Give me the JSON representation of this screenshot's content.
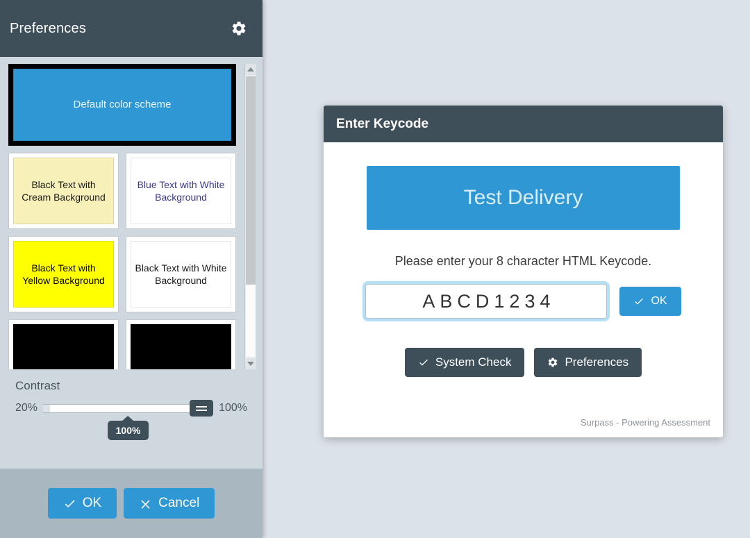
{
  "preferences": {
    "title": "Preferences",
    "gear_icon": "gear-icon",
    "schemes": [
      {
        "label": "Default color scheme",
        "bg": "#2f97d4",
        "fg": "#e9f5fd",
        "selected": true,
        "size": "wide"
      },
      {
        "label": "Black Text with Cream Background",
        "bg": "#f7f0b8",
        "fg": "#1a1a1a",
        "selected": false,
        "size": "half"
      },
      {
        "label": "Blue Text with White Background",
        "bg": "#ffffff",
        "fg": "#3a3a8c",
        "selected": false,
        "size": "half"
      },
      {
        "label": "Black Text with Yellow Background",
        "bg": "#ffff00",
        "fg": "#000000",
        "selected": false,
        "size": "half"
      },
      {
        "label": "Black Text with White Background",
        "bg": "#ffffff",
        "fg": "#1a1a1a",
        "selected": false,
        "size": "half"
      },
      {
        "label": "",
        "bg": "#000000",
        "fg": "#ffffff",
        "selected": false,
        "size": "cut"
      },
      {
        "label": "",
        "bg": "#000000",
        "fg": "#ffffff",
        "selected": false,
        "size": "cut"
      }
    ],
    "contrast": {
      "label": "Contrast",
      "min_label": "20%",
      "max_label": "100%",
      "value_label": "100%",
      "value": 100,
      "min": 20,
      "max": 100
    },
    "buttons": {
      "ok": "OK",
      "cancel": "Cancel"
    }
  },
  "keycode_dialog": {
    "title": "Enter Keycode",
    "banner": "Test Delivery",
    "instruction": "Please enter your 8 character HTML Keycode.",
    "input_value": "ABCD1234",
    "input_placeholder": "",
    "ok_label": "OK",
    "system_check_label": "System Check",
    "preferences_label": "Preferences",
    "footnote": "Surpass - Powering Assessment"
  },
  "colors": {
    "accent_blue": "#2f97d4",
    "dark_slate": "#3e4f5a",
    "panel_bg": "#ced8de",
    "page_bg": "#dce2e9",
    "footer_bg": "#a9b7c1"
  }
}
